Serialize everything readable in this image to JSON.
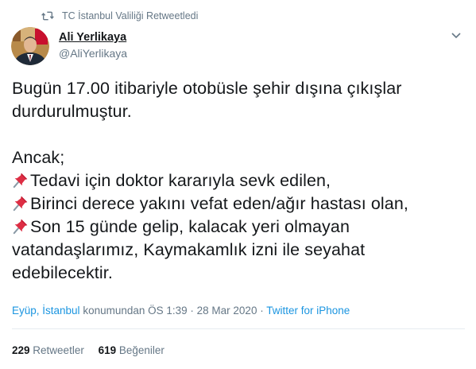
{
  "retweet_context": {
    "icon": "retweet-icon",
    "label": "TC İstanbul Valiliği Retweetledi"
  },
  "author": {
    "avatar_icon": "avatar-photo",
    "name": "Ali Yerlikaya",
    "handle": "@AliYerlikaya"
  },
  "menu": {
    "icon": "chevron-down-icon"
  },
  "tweet": {
    "line1": "Bugün 17.00 itibariyle otobüsle şehir dışına çıkışlar",
    "line2": "durdurulmuştur.",
    "line3": "Ancak;",
    "pin_icon": "pushpin-icon",
    "item1": "Tedavi için doktor kararıyla sevk edilen,",
    "item2": "Birinci derece yakını vefat eden/ağır hastası olan,",
    "item3_a": "Son 15 günde gelip, kalacak yeri olmayan",
    "item3_b": "vatandaşlarımız, Kaymakamlık izni ile seyahat",
    "item3_c": "edebilecektir."
  },
  "meta": {
    "location": "Eyüp, İstanbul",
    "location_suffix": " konumundan ",
    "timestamp": "ÖS 1:39 · 28 Mar 2020",
    "separator": " · ",
    "source": "Twitter for iPhone"
  },
  "stats": {
    "retweets_count": "229",
    "retweets_label": "Retweetler",
    "likes_count": "619",
    "likes_label": "Beğeniler"
  },
  "colors": {
    "link": "#1b95e0",
    "secondary": "#657786",
    "text": "#14171a",
    "divider": "#e6ecf0"
  }
}
